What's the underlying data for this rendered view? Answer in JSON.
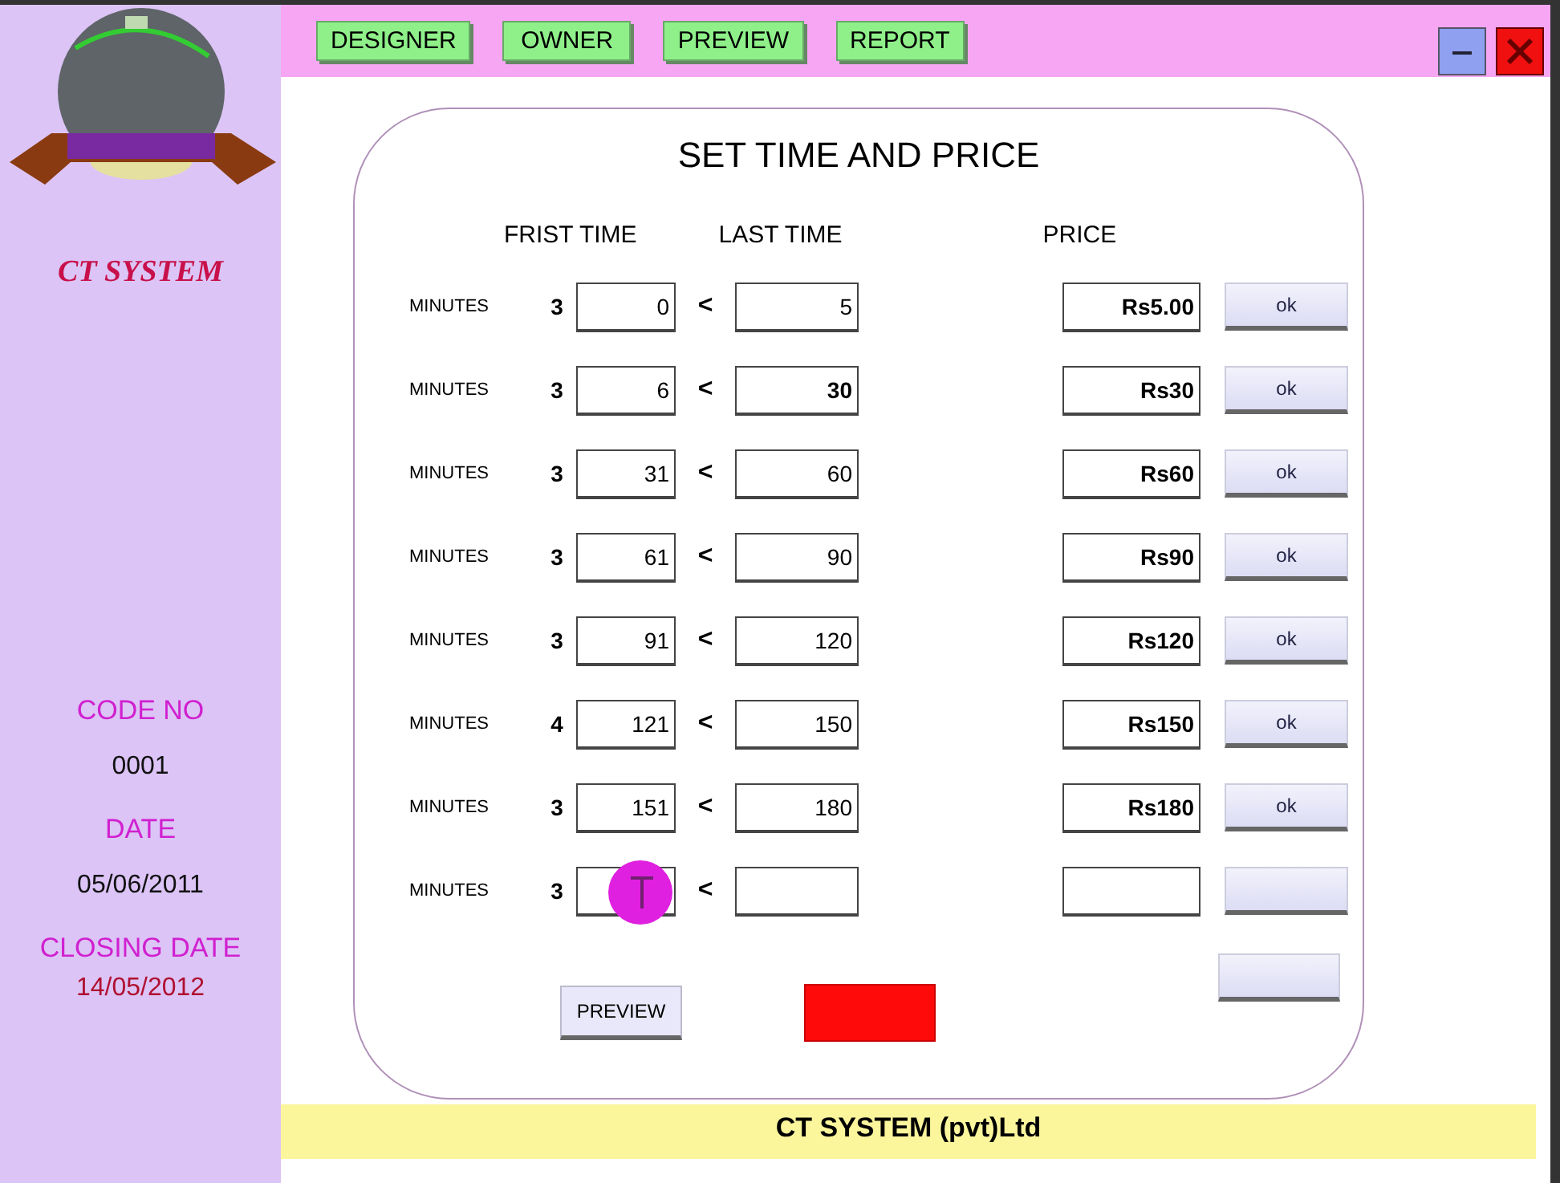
{
  "nav": [
    {
      "label": "DESIGNER"
    },
    {
      "label": "OWNER"
    },
    {
      "label": "PREVIEW"
    },
    {
      "label": "REPORT"
    }
  ],
  "sidebar": {
    "brand": "CT SYSTEM",
    "fields": [
      {
        "label": "CODE NO",
        "value": "0001",
        "kind": "plain"
      },
      {
        "label": "DATE",
        "value": "05/06/2011",
        "kind": "plain"
      },
      {
        "label": "CLOSING DATE",
        "value": "14/05/2012",
        "kind": "alert"
      }
    ]
  },
  "panel": {
    "title": "SET TIME AND PRICE",
    "headers": {
      "first": "FRIST TIME",
      "last": "LAST TIME",
      "price": "PRICE"
    },
    "rows": [
      {
        "unit": "MINUTES",
        "count": "3",
        "first": "0",
        "separator": "<",
        "last": "5",
        "price": "Rs5.00",
        "button": "ok",
        "pointer": false
      },
      {
        "unit": "MINUTES",
        "count": "3",
        "first": "6",
        "separator": "<",
        "last": "30",
        "price": "Rs30",
        "button": "ok",
        "pointer": false
      },
      {
        "unit": "MINUTES",
        "count": "3",
        "first": "31",
        "separator": "<",
        "last": "60",
        "price": "Rs60",
        "button": "ok",
        "pointer": false
      },
      {
        "unit": "MINUTES",
        "count": "3",
        "first": "61",
        "separator": "<",
        "last": "90",
        "price": "Rs90",
        "button": "ok",
        "pointer": false
      },
      {
        "unit": "MINUTES",
        "count": "3",
        "first": "91",
        "separator": "<",
        "last": "120",
        "price": "Rs120",
        "button": "ok",
        "pointer": false
      },
      {
        "unit": "MINUTES",
        "count": "4",
        "first": "121",
        "separator": "<",
        "last": "150",
        "price": "Rs150",
        "button": "ok",
        "pointer": false
      },
      {
        "unit": "MINUTES",
        "count": "3",
        "first": "151",
        "separator": "<",
        "last": "180",
        "price": "Rs180",
        "button": "ok",
        "pointer": false
      },
      {
        "unit": "MINUTES",
        "count": "3",
        "separator": "<",
        "pointer": true
      }
    ],
    "actions": [
      {
        "kind": "preview",
        "label": "PREVIEW"
      },
      {
        "kind": "exit"
      }
    ]
  },
  "footer": "CT SYSTEM (pvt)Ltd"
}
